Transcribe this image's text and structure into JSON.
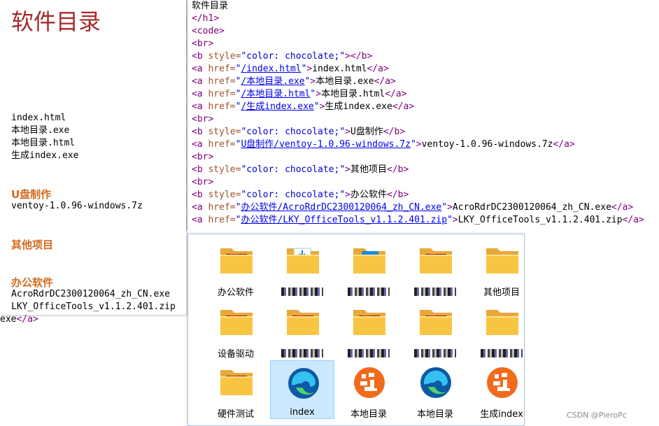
{
  "browser": {
    "h1": "软件目录",
    "links_local": [
      "index.html",
      "本地目录.exe",
      "本地目录.html",
      "生成index.exe"
    ],
    "heading_usb": "U盘制作",
    "link_usb": "ventoy-1.0.96-windows.7z",
    "heading_other": "其他项目",
    "heading_office": "办公软件",
    "links_office": [
      "AcroRdrDC2300120064_zh_CN.exe",
      "LKY_OfficeTools_v1.1.2.401.zip"
    ],
    "overflow_tail": "exe",
    "overflow_tail_tag": "</a>"
  },
  "source": {
    "lines": [
      "软件目录",
      "</h1>",
      "<code>",
      "<br>",
      "<b style=\"color: chocolate;\"></b>",
      "<a href=\"/index.html\">index.html</a>",
      "<a href=\"/本地目录.exe\">本地目录.exe</a>",
      "<a href=\"/本地目录.html\">本地目录.html</a>",
      "<a href=\"/生成index.exe\">生成index.exe</a>",
      "<br>",
      "<b style=\"color: chocolate;\">U盘制作</b>",
      "<a href=\"U盘制作/ventoy-1.0.96-windows.7z\">ventoy-1.0.96-windows.7z</a>",
      "<br>",
      "<b style=\"color: chocolate;\">其他项目</b>",
      "<br>",
      "<b style=\"color: chocolate;\">办公软件</b>",
      "<a href=\"办公软件/AcroRdrDC2300120064_zh_CN.exe\">AcroRdrDC2300120064_zh_CN.exe</a>",
      "<a href=\"办公软件/LKY_OfficeTools_v1.1.2.401.zip\">LKY_OfficeTools_v1.1.2.401.zip</a>"
    ],
    "colors": {
      "tag": "#800080",
      "attr": "#a0522d",
      "string": "#0000cc",
      "link": "#0000ee"
    }
  },
  "explorer": {
    "items": [
      {
        "label": "办公软件",
        "icon": "folder-icon",
        "hidden": false
      },
      {
        "label": "",
        "icon": "folder-download-icon",
        "hidden": true
      },
      {
        "label": "",
        "icon": "folder-image-icon",
        "hidden": true
      },
      {
        "label": "",
        "icon": "folder-icon",
        "hidden": true
      },
      {
        "label": "其他项目",
        "icon": "folder-empty-icon",
        "hidden": false
      },
      {
        "label": "设备驱动",
        "icon": "folder-icon",
        "hidden": false
      },
      {
        "label": "",
        "icon": "folder-icon",
        "hidden": true
      },
      {
        "label": "",
        "icon": "folder-icon",
        "hidden": true
      },
      {
        "label": "",
        "icon": "folder-icon",
        "hidden": true
      },
      {
        "label": "",
        "icon": "folder-app-icon",
        "hidden": true
      },
      {
        "label": "硬件测试",
        "icon": "folder-icon",
        "hidden": false
      },
      {
        "label": "index",
        "icon": "edge-icon",
        "hidden": false,
        "selected": true
      },
      {
        "label": "本地目录",
        "icon": "orange-app-icon",
        "hidden": false
      },
      {
        "label": "本地目录",
        "icon": "edge-icon",
        "hidden": false
      },
      {
        "label": "生成index",
        "icon": "orange-app-icon",
        "hidden": false
      }
    ]
  },
  "colors": {
    "heading": "#d2691e",
    "h1": "#a52a2a",
    "folder": "#f8c543",
    "selected": "#cce8ff"
  },
  "watermark": "CSDN @PieroPc"
}
